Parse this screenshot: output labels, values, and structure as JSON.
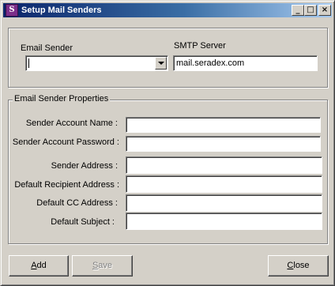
{
  "window": {
    "title": "Setup Mail Senders",
    "app_icon_glyph": "S",
    "app_icon_color": "#7b2e8a",
    "title_bar_colors": [
      "#0a246a",
      "#a6caf0"
    ],
    "caption_buttons": {
      "minimize": "_",
      "maximize": "□",
      "close": "×"
    }
  },
  "top_group": {
    "email_sender_label": "Email Sender",
    "email_sender_value": "",
    "smtp_server_label": "SMTP Server",
    "smtp_server_value": "mail.seradex.com"
  },
  "properties_group": {
    "title": "Email Sender Properties",
    "fields": [
      {
        "label": "Sender Account Name :",
        "value": ""
      },
      {
        "label": "Sender Account Password :",
        "value": ""
      },
      {
        "label": "Sender Address :",
        "value": ""
      },
      {
        "label": "Default Recipient Address :",
        "value": ""
      },
      {
        "label": "Default CC Address :",
        "value": ""
      },
      {
        "label": "Default Subject :",
        "value": ""
      }
    ]
  },
  "buttons": {
    "add": {
      "mnemonic": "A",
      "rest": "dd",
      "enabled": true
    },
    "save": {
      "mnemonic": "S",
      "rest": "ave",
      "enabled": false
    },
    "close": {
      "mnemonic": "C",
      "rest": "lose",
      "enabled": true
    }
  }
}
